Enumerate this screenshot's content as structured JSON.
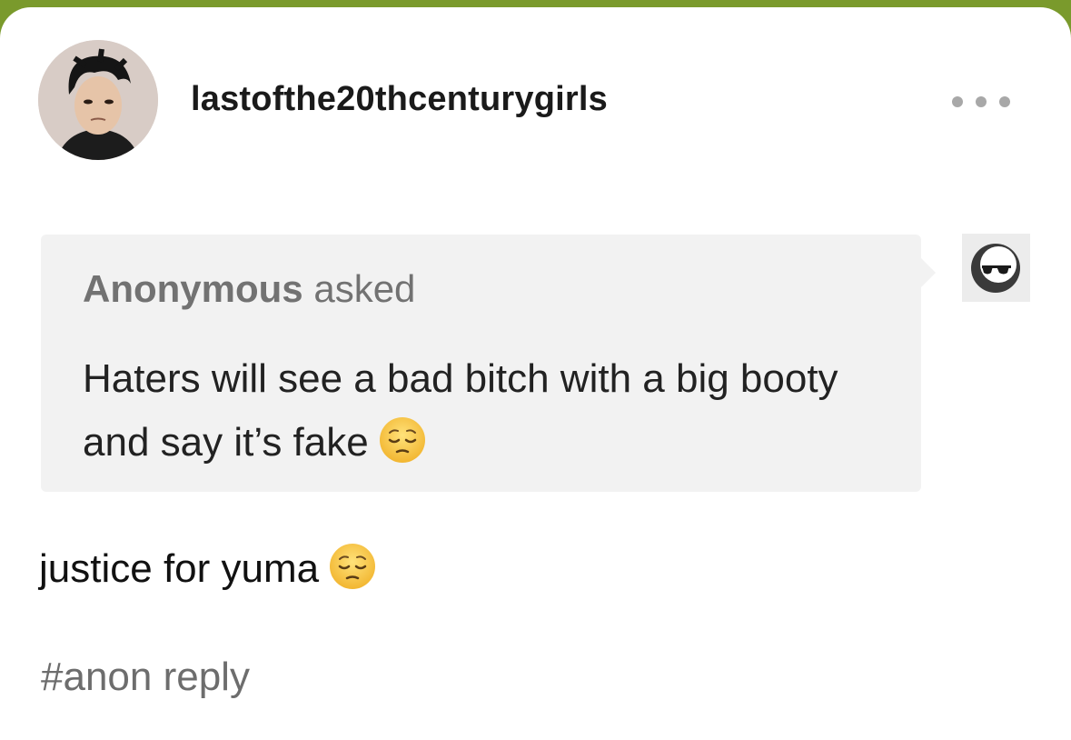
{
  "post": {
    "username": "lastofthe20thcenturygirls",
    "avatar_icon": "user-avatar-photo",
    "more_icon": "more-dots-icon",
    "ask": {
      "asker": "Anonymous",
      "verb": "asked",
      "question": "Haters will see a bad bitch with a big booty and say it’s fake",
      "question_emoji": "pensive-face-emoji",
      "asker_avatar_icon": "anonymous-sunglasses-icon"
    },
    "reply": "justice for yuma",
    "reply_emoji": "pensive-face-emoji",
    "tags": [
      "#anon reply"
    ]
  },
  "colors": {
    "header_bar": "#7a9a2c",
    "ask_background": "#f2f2f2",
    "muted_text": "#727272"
  }
}
